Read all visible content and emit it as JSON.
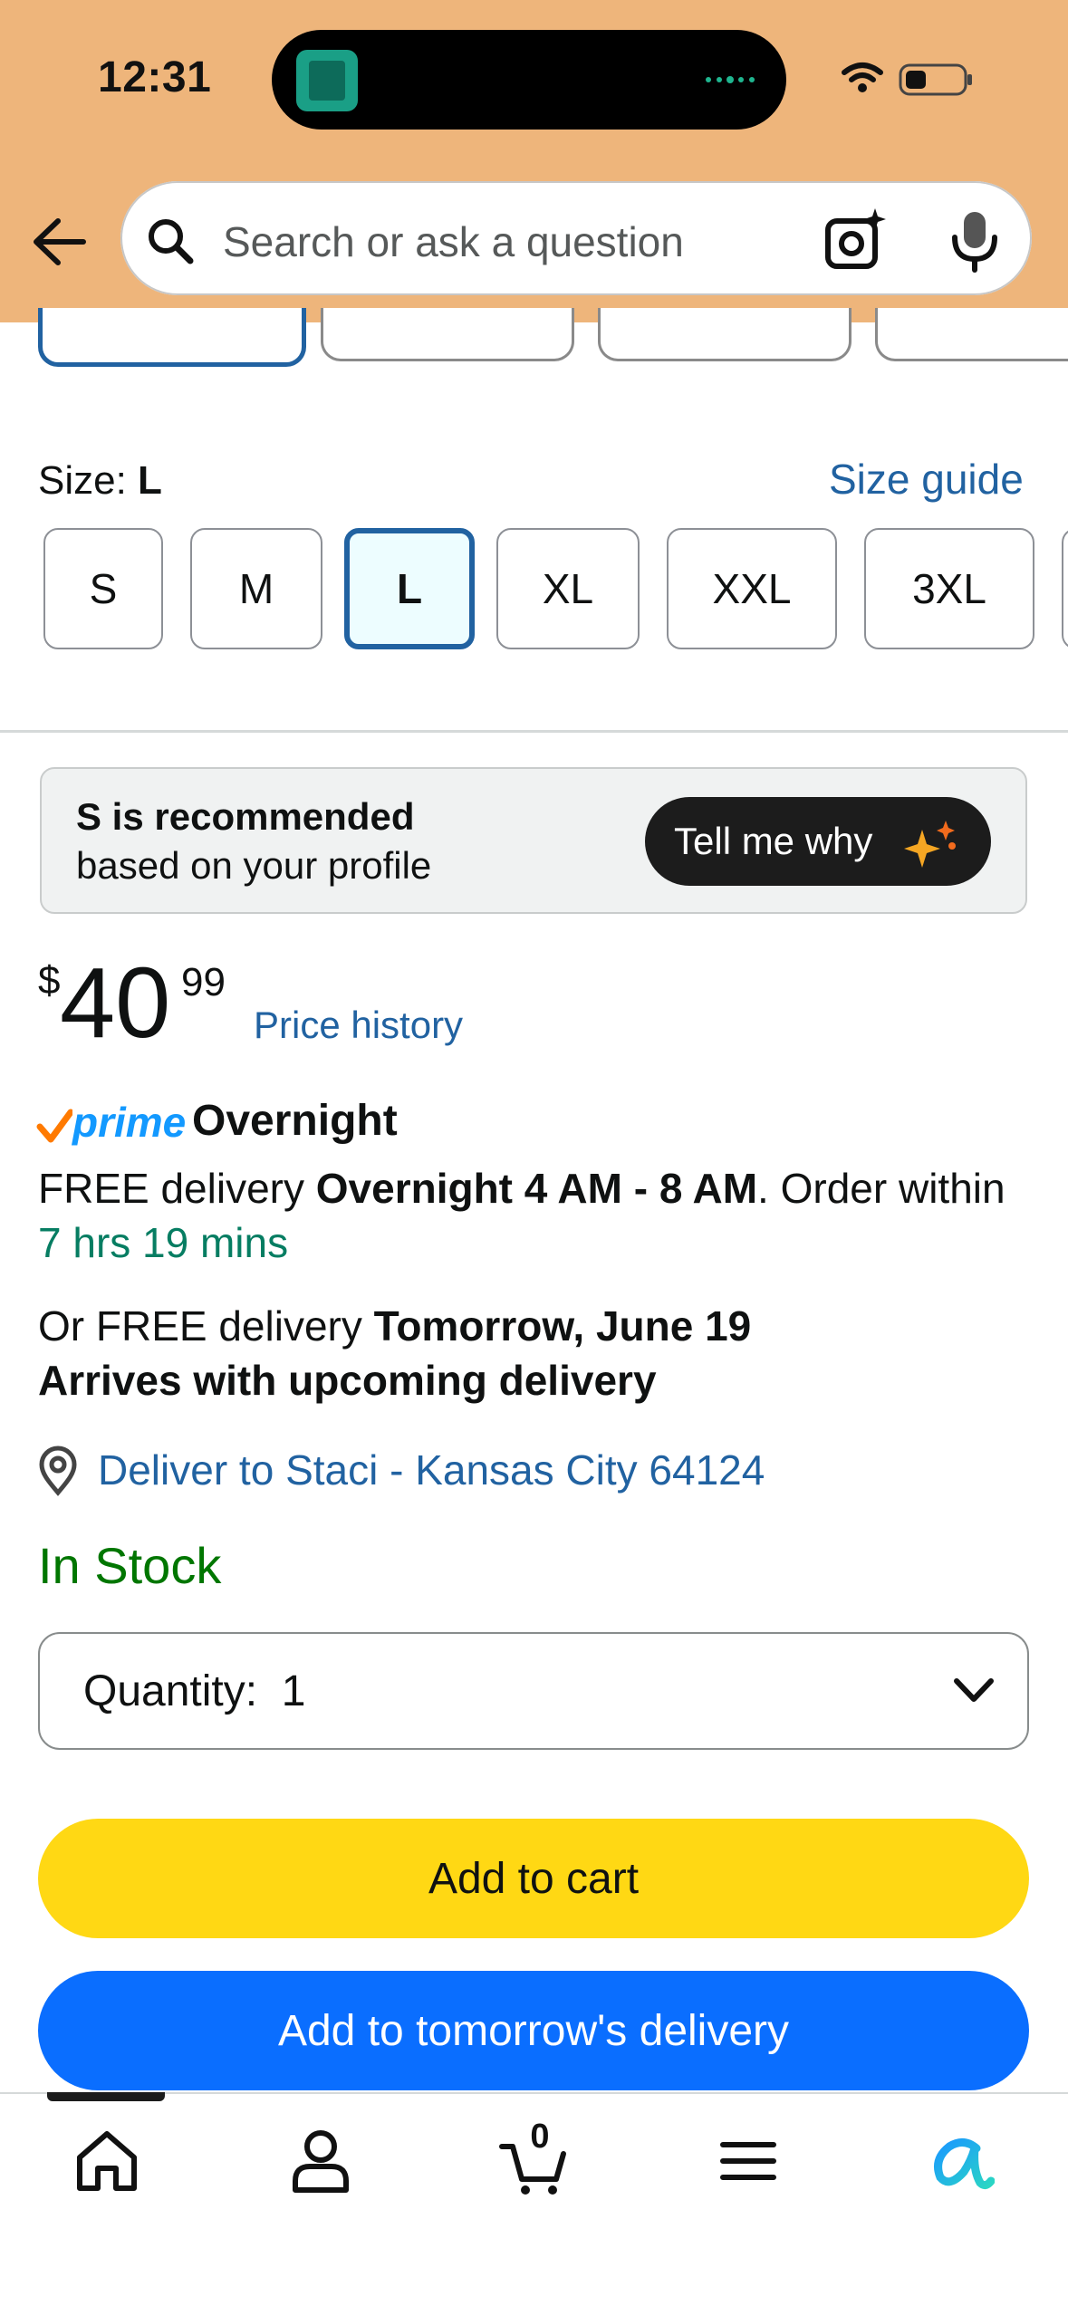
{
  "status_bar": {
    "time": "12:31"
  },
  "search": {
    "placeholder": "Search or ask a question"
  },
  "size": {
    "label": "Size: ",
    "selected": "L",
    "guide_link": "Size guide",
    "options": [
      "S",
      "M",
      "L",
      "XL",
      "XXL",
      "3XL"
    ]
  },
  "recommendation": {
    "title": "S is recommended",
    "subtitle": "based on your profile",
    "button": "Tell me why"
  },
  "price": {
    "symbol": "$",
    "whole": "40",
    "fraction": "99",
    "history_link": "Price history"
  },
  "delivery": {
    "prime_label": "prime",
    "prime_speed": "Overnight",
    "line1_a": "FREE delivery ",
    "line1_b": "Overnight 4 AM - 8 AM",
    "line1_c": ". Order within ",
    "line1_countdown": "7 hrs 19 mins",
    "line2_a": "Or FREE delivery ",
    "line2_b": "Tomorrow, June 19",
    "line2_c": "Arrives with upcoming delivery",
    "deliver_to": "Deliver to Staci - Kansas City 64124"
  },
  "stock": {
    "status": "In Stock"
  },
  "quantity": {
    "label": "Quantity:",
    "value": "1"
  },
  "actions": {
    "add_to_cart": "Add to cart",
    "add_to_tomorrow": "Add to tomorrow's delivery"
  },
  "bottom_nav": {
    "items": [
      "home-icon",
      "account-icon",
      "cart-icon",
      "menu-icon",
      "rufus-icon"
    ],
    "cart_count": "0"
  },
  "colors": {
    "header_bg": "#eeb57b",
    "link": "#2162a1",
    "add_to_cart": "#ffd814",
    "add_to_tomorrow": "#0a6eff",
    "in_stock": "#007600",
    "countdown": "#067d62",
    "prime": "#1399ff"
  }
}
